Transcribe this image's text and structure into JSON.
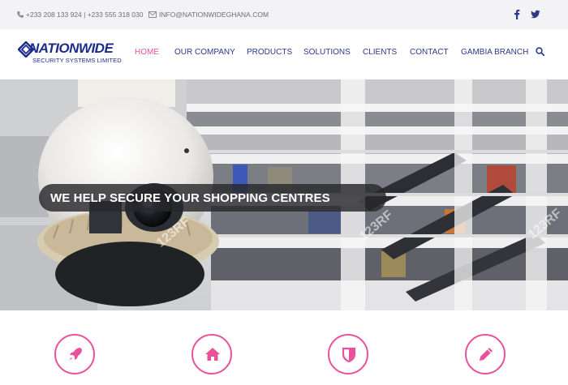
{
  "topbar": {
    "phone": "+233 208 133 924 | +233 555 318 030",
    "email": "INFO@NATIONWIDEGHANA.COM",
    "social": [
      "facebook-icon",
      "twitter-icon"
    ]
  },
  "logo": {
    "title": "NATIONWIDE",
    "subtitle": "SECURITY SYSTEMS LIMITED"
  },
  "nav": {
    "items": [
      {
        "label": "HOME",
        "active": true
      },
      {
        "label": "OUR COMPANY",
        "active": false
      },
      {
        "label": "PRODUCTS",
        "active": false
      },
      {
        "label": "SOLUTIONS",
        "active": false
      },
      {
        "label": "CLIENTS",
        "active": false
      },
      {
        "label": "CONTACT",
        "active": false
      },
      {
        "label": "GAMBIA BRANCH",
        "active": false
      }
    ],
    "search_icon": "search-icon"
  },
  "hero": {
    "headline": "WE HELP SECURE YOUR SHOPPING CENTRES",
    "watermark": "123RF"
  },
  "features": [
    {
      "icon": "rocket-icon"
    },
    {
      "icon": "home-icon"
    },
    {
      "icon": "shield-icon"
    },
    {
      "icon": "pencil-icon"
    }
  ],
  "colors": {
    "accent": "#e8529a",
    "brand": "#1d2c8c",
    "nav": "#2d3a8c",
    "topbar_bg": "#f3f3f5"
  }
}
